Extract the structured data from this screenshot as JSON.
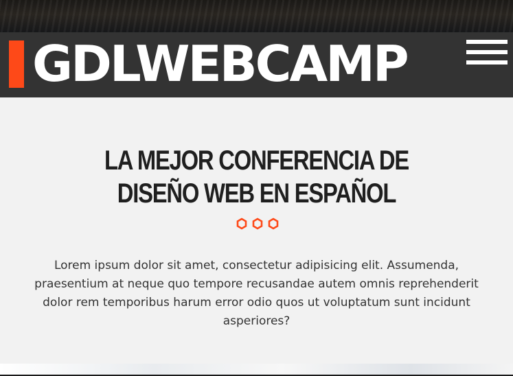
{
  "header": {
    "brand": "GDLWEBCAMP",
    "menu_icon": "hamburger-menu-icon"
  },
  "intro": {
    "title": "LA MEJOR CONFERENCIA DE DISEÑO WEB EN ESPAÑOL",
    "divider_icon": "hexagon-icon",
    "paragraph": "Lorem ipsum dolor sit amet, consectetur adipisicing elit. Assumenda, praesentium at neque quo tempore recusandae autem omnis reprehenderit dolor rem temporibus harum error odio quos ut voluptatum sunt incidunt asperiores?"
  },
  "colors": {
    "accent": "#fe4918",
    "navbar": "#333333",
    "background": "#f2f2f2",
    "text": "#333333"
  }
}
